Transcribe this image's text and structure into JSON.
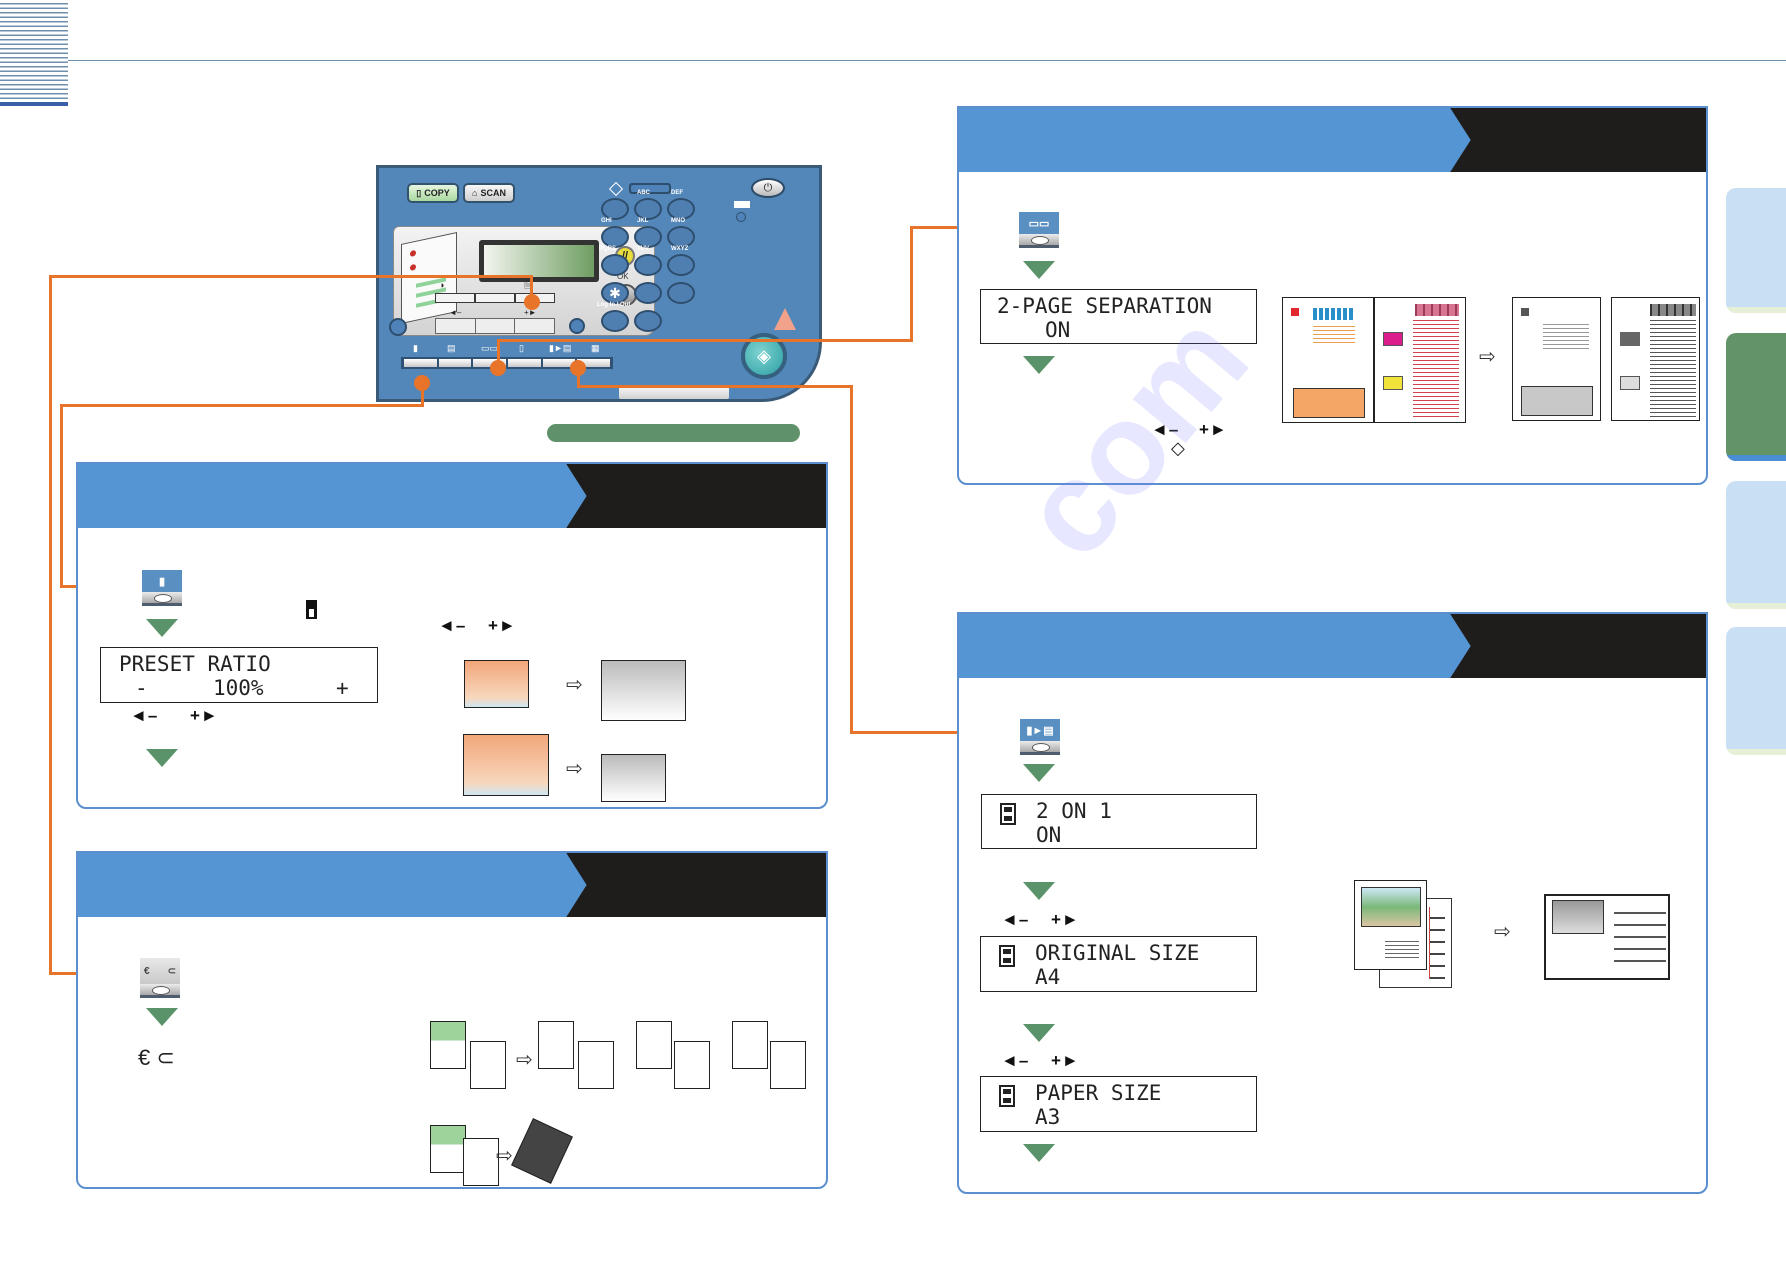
{
  "header": {
    "title": "",
    "accent_color": "#3a5fa8",
    "line_color": "#6e92ad"
  },
  "printer_panel": {
    "mode_buttons": [
      {
        "label": "COPY",
        "icon": "copy-icon",
        "active": true
      },
      {
        "label": "SCAN",
        "icon": "scan-icon",
        "active": false
      }
    ],
    "keypad_labels": [
      "ABC",
      "DEF",
      "GHI",
      "JKL",
      "MNO",
      "PQRS",
      "TUV",
      "WXYZ",
      "Log In / Out"
    ],
    "settings_labels": {
      "minus": "◄–",
      "plus": "+►",
      "ok": "OK"
    },
    "function_keys": [
      "enlarge-reduce",
      "paper-select",
      "2-page-separation",
      "density",
      "2-on-1",
      "image-quality"
    ],
    "start_icon": "start-icon",
    "power_icon": "power-icon"
  },
  "sections": {
    "ratio": {
      "title": "",
      "key_icon": "enlarge-reduce-key-icon",
      "display": {
        "line1": "PRESET RATIO",
        "line2_minus": "-",
        "line2_value": "100%",
        "line2_plus": "+"
      },
      "adjust_keys": {
        "minus": "◄–",
        "plus": "+►"
      },
      "adjust_keys_right": {
        "minus": "◄–",
        "plus": "+►"
      }
    },
    "collate": {
      "title": "",
      "key_icon": "collate-group-key-icon",
      "mode_icons": [
        "collate-icon",
        "group-icon"
      ]
    },
    "two_page_separation": {
      "title": "",
      "key_icon": "two-page-separation-key-icon",
      "display": {
        "line1": "2-PAGE SEPARATION",
        "line2": "ON"
      },
      "adjust_keys": {
        "minus": "◄–",
        "plus": "+►"
      },
      "start_symbol": "◇"
    },
    "two_on_one": {
      "title": "",
      "key_icon": "two-on-one-key-icon",
      "displays": [
        {
          "line1": "2 ON 1",
          "line2": "ON"
        },
        {
          "line1": "ORIGINAL SIZE",
          "line2": "A4"
        },
        {
          "line1": "PAPER SIZE",
          "line2": "A3"
        }
      ],
      "adjust_keys": {
        "minus": "◄–",
        "plus": "+►"
      }
    }
  },
  "side_tabs": [
    {
      "state": "inactive",
      "color": "#c9e0f4",
      "lip": "#e5f0d6"
    },
    {
      "state": "active",
      "color": "#629468",
      "lip": "#4a8fd6"
    },
    {
      "state": "inactive",
      "color": "#c9e0f4",
      "lip": "#e5f0d6"
    },
    {
      "state": "inactive",
      "color": "#c9e0f4",
      "lip": "#e5f0d6"
    }
  ],
  "colors": {
    "panel_blue": "#5595d4",
    "panel_dark": "#1f1c1c",
    "connector_orange": "#e8742a",
    "step_arrow_green": "#5a9369",
    "printer_blue": "#5387b9"
  }
}
